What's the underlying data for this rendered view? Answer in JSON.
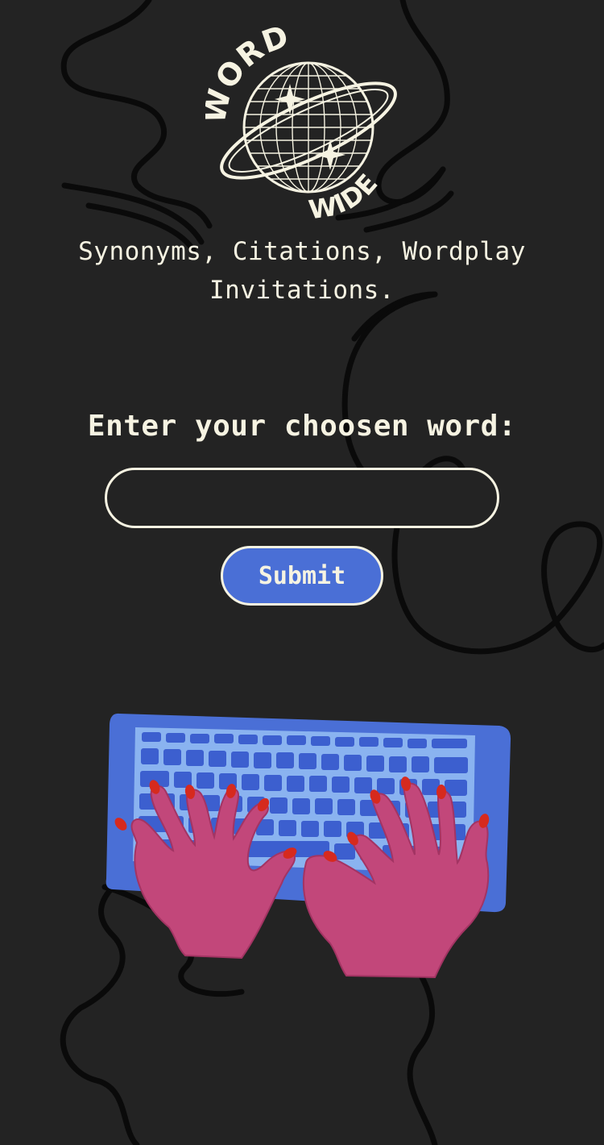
{
  "brand": {
    "logo_top_word": "WORD",
    "logo_bottom_word": "WIDE"
  },
  "tagline": {
    "line1": "Synonyms, Citations, Wordplay",
    "line2": "Invitations."
  },
  "form": {
    "prompt": "Enter your choosen word:",
    "input_value": "",
    "input_placeholder": "",
    "submit_label": "Submit"
  },
  "colors": {
    "background": "#232323",
    "text": "#f6f3e2",
    "accent": "#4a6fd6",
    "hands": "#c2477a",
    "nails": "#d62a1e"
  },
  "illustration": {
    "icon": "hands-typing-on-keyboard-icon"
  }
}
